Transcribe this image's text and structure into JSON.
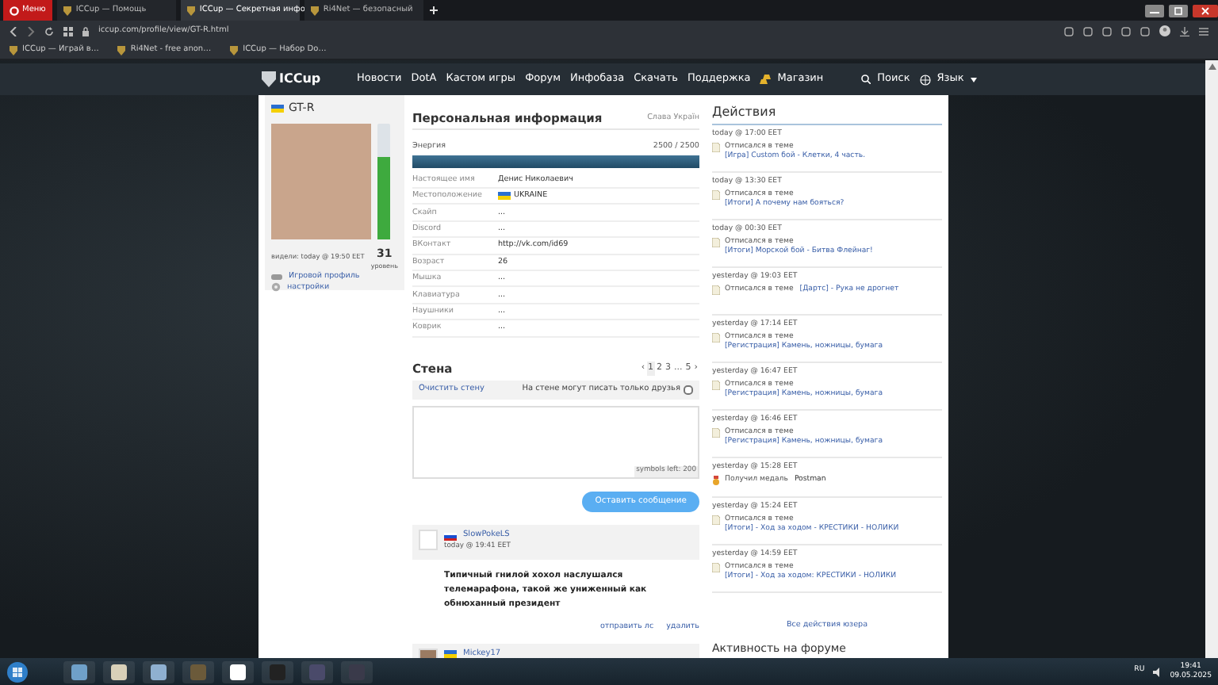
{
  "browser": {
    "menu_label": "Меню",
    "tabs": [
      {
        "title": "ICCup — Помощь",
        "selected": false
      },
      {
        "title": "ICCup — Секретная инфо",
        "selected": true
      },
      {
        "title": "Ri4Net — безопасный",
        "selected": false
      }
    ],
    "address": "iccup.com/profile/view/GT-R.html",
    "bookmarks": [
      "ICCup — Играй в…",
      "Ri4Net - free anon…",
      "ICCup — Набор Dо…"
    ]
  },
  "site_nav": {
    "logo": "ICCup",
    "links": [
      "Новости",
      "DotA",
      "Кастом игры",
      "Форум",
      "Инфобаза",
      "Скачать",
      "Поддержка"
    ],
    "shop": "Магазин",
    "search": "Поиск",
    "language": "Язык"
  },
  "profile": {
    "name": "GT-R",
    "flag": {
      "kind": "ua"
    },
    "level_meter": {
      "level": 0.7
    },
    "level": "31",
    "level_label": "уровень",
    "seen": "видели: today @ 19:50 EET",
    "links": [
      "Игровой профиль",
      "настройки"
    ]
  },
  "personal": {
    "title": "Персональная информация",
    "status": "Слава Україн",
    "energy": {
      "label": "Энергия",
      "value": "2500 / 2500",
      "level": 1
    },
    "fields": [
      {
        "label": "Настоящее имя",
        "value": "Денис Николаевич"
      },
      {
        "label": "Местоположение",
        "value": "UKRAINE",
        "flag": {
          "kind": "ua"
        }
      },
      {
        "label": "Скайп",
        "value": "..."
      },
      {
        "label": "Discord",
        "value": "..."
      },
      {
        "label": "ВКонтакт",
        "value": "http://vk.com/id69"
      },
      {
        "label": "Возраст",
        "value": "26"
      },
      {
        "label": "Мышка",
        "value": "..."
      },
      {
        "label": "Клавиатура",
        "value": "..."
      },
      {
        "label": "Наушники",
        "value": "..."
      },
      {
        "label": "Коврик",
        "value": "..."
      }
    ]
  },
  "wall": {
    "title": "Стена",
    "pages": [
      {
        "label": "‹",
        "selected": false
      },
      {
        "label": "1",
        "selected": true
      },
      {
        "label": "2",
        "selected": false
      },
      {
        "label": "3",
        "selected": false
      },
      {
        "label": "...",
        "selected": false
      },
      {
        "label": "5",
        "selected": false
      },
      {
        "label": "›",
        "selected": false
      }
    ],
    "clear": "Очистить стену",
    "friends_only": {
      "label": "На стене могут писать только друзья",
      "checked": false
    },
    "counter": "symbols left: 200",
    "submit": "Оставить сообщение",
    "posts": [
      {
        "author": "SlowPokeLS",
        "flag": {
          "kind": "ru"
        },
        "avatar": {
          "kind": "blank"
        },
        "time": "today @ 19:41 EET",
        "text": "Типичный гнилой хохол наслушался телемарафона, такой же униженный как обнюханный президент",
        "actions": [
          "отправить лс",
          "удалить"
        ]
      },
      {
        "author": "Mickey17",
        "flag": {
          "kind": "ua"
        },
        "avatar": {
          "kind": "photo"
        }
      }
    ]
  },
  "actions": {
    "title": "Действия",
    "items": [
      {
        "time": "today @ 17:00 EET",
        "kind": "post",
        "text": "Отписался в теме",
        "link": "[Игра] Custom бой - Клетки, 4 часть."
      },
      {
        "time": "today @ 13:30 EET",
        "kind": "post",
        "text": "Отписался в теме",
        "link": "[Итоги] А почему нам бояться?"
      },
      {
        "time": "today @ 00:30 EET",
        "kind": "post",
        "text": "Отписался в теме",
        "link": "[Итоги] Морской бой - Битва Флейнаг!"
      },
      {
        "time": "yesterday @ 19:03 EET",
        "kind": "post_inline",
        "text": "Отписался в теме",
        "link": "[Дартс] - Рука не дрогнет"
      },
      {
        "time": "yesterday @ 17:14 EET",
        "kind": "post",
        "text": "Отписался в теме",
        "link": "[Регистрация] Камень, ножницы, бумага"
      },
      {
        "time": "yesterday @ 16:47 EET",
        "kind": "post",
        "text": "Отписался в теме",
        "link": "[Регистрация] Камень, ножницы, бумага"
      },
      {
        "time": "yesterday @ 16:46 EET",
        "kind": "post",
        "text": "Отписался в теме",
        "link": "[Регистрация] Камень, ножницы, бумага"
      },
      {
        "time": "yesterday @ 15:28 EET",
        "kind": "medal",
        "text": "Получил медаль",
        "link": "Postman"
      },
      {
        "time": "yesterday @ 15:24 EET",
        "kind": "post",
        "text": "Отписался в теме",
        "link": "[Итоги] - Ход за ходом - КРЕСТИКИ - НОЛИКИ"
      },
      {
        "time": "yesterday @ 14:59 EET",
        "kind": "post",
        "text": "Отписался в теме",
        "link": "[Итоги] - Ход за ходом: КРЕСТИКИ - НОЛИКИ"
      }
    ],
    "all_link": "Все действия юзера"
  },
  "forum": {
    "title": "Активность на форуме"
  },
  "taskbar": {
    "language": "RU",
    "time": "19:41",
    "date": "09.05.2025"
  }
}
